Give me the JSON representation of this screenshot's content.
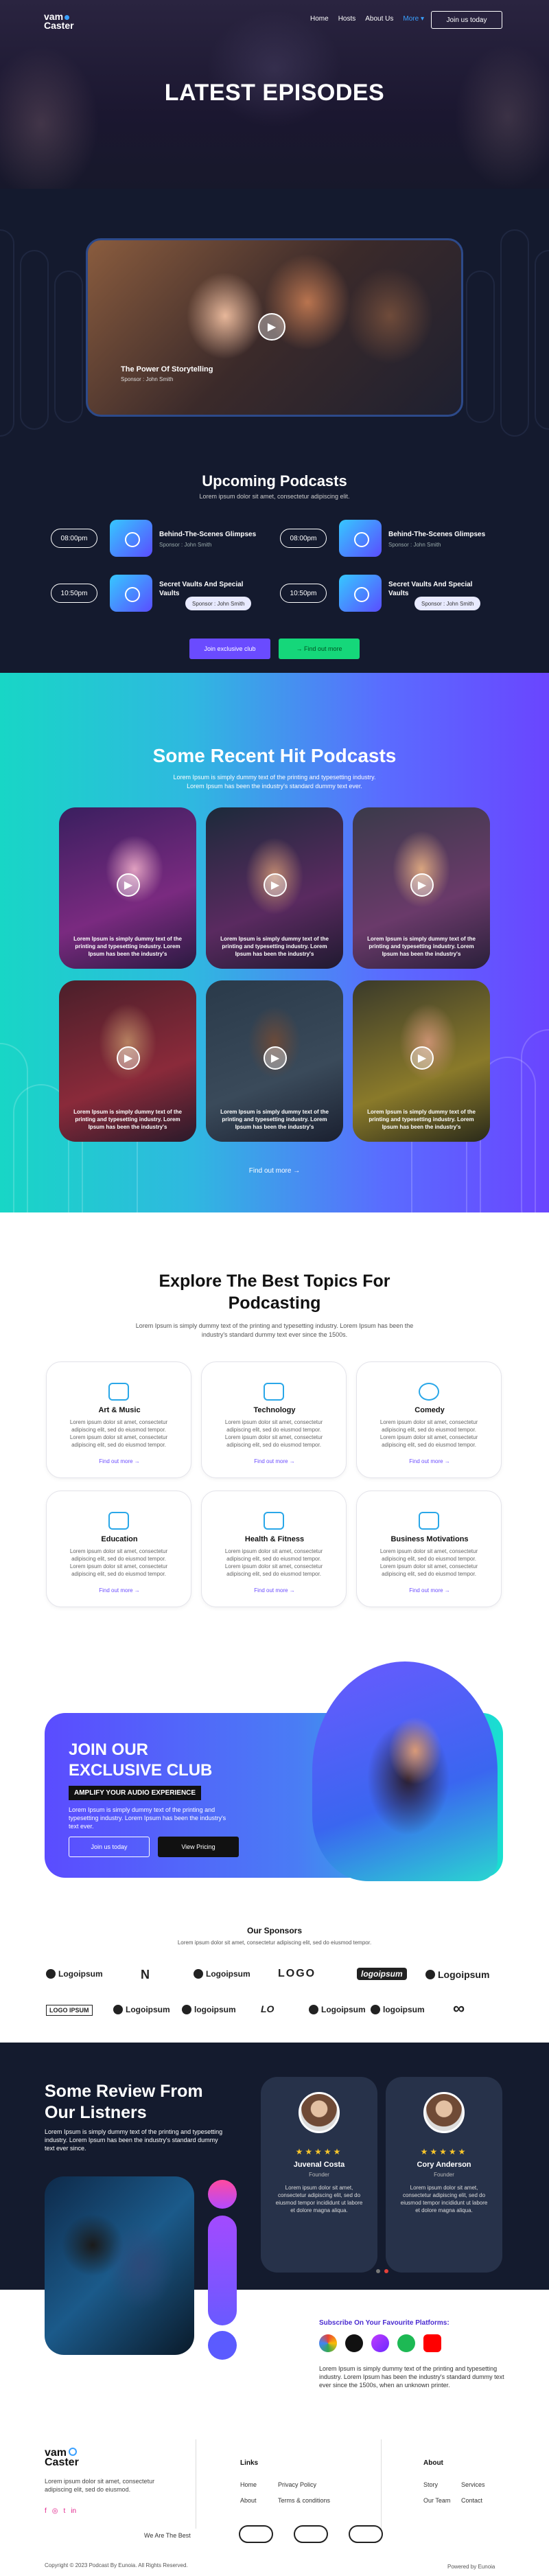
{
  "nav": {
    "logo_line1": "vam",
    "logo_line2": "Caster",
    "links": [
      "Home",
      "Hosts",
      "About Us",
      "More ▾"
    ],
    "join_label": "Join us today"
  },
  "hero": {
    "title": "LATEST EPISODES"
  },
  "featured": {
    "title": "The Power Of Storytelling",
    "sponsor": "Sponsor : John Smith"
  },
  "upcoming": {
    "title": "Upcoming Podcasts",
    "subtitle": "Lorem ipsum dolor sit amet, consectetur adipiscing elit.",
    "items": [
      {
        "time": "08:00pm",
        "title": "Behind-The-Scenes Glimpses",
        "sponsor": "Sponsor : John Smith"
      },
      {
        "time": "08:00pm",
        "title": "Behind-The-Scenes Glimpses",
        "sponsor": "Sponsor : John Smith"
      },
      {
        "time": "10:50pm",
        "title": "Secret Vaults And Special Vaults",
        "sponsor": "Sponsor : John Smith"
      },
      {
        "time": "10:50pm",
        "title": "Secret Vaults And Special Vaults",
        "sponsor": "Sponsor : John Smith"
      }
    ],
    "club_btn": "Join exclusive club",
    "find_btn": "→ Find out more"
  },
  "hits": {
    "title": "Some Recent Hit Podcasts",
    "subtitle": "Lorem Ipsum is simply dummy text of the printing and typesetting industry. Lorem Ipsum has been the industry's standard dummy text ever.",
    "card_text": "Lorem Ipsum is simply dummy text of the printing and typesetting industry. Lorem Ipsum has been the industry's",
    "find_more": "Find out more →"
  },
  "topics": {
    "title_line1": "Explore The Best Topics For",
    "title_line2": "Podcasting",
    "subtitle": "Lorem Ipsum is simply dummy text of the printing and typesetting industry. Lorem Ipsum has been the industry's standard dummy text ever since the 1500s.",
    "card_text": "Lorem ipsum dolor sit amet, consectetur adipiscing elit, sed do eiusmod tempor. Lorem ipsum dolor sit amet, consectetur adipiscing elit, sed do eiusmod tempor.",
    "find_more": "Find out more →",
    "items": [
      "Art & Music",
      "Technology",
      "Comedy",
      "Education",
      "Health & Fitness",
      "Business Motivations"
    ]
  },
  "club": {
    "line1": "JOIN OUR",
    "line2": "EXCLUSIVE CLUB",
    "tag": "AMPLIFY YOUR AUDIO EXPERIENCE",
    "text": "Lorem Ipsum is simply dummy text of the printing and typesetting industry. Lorem Ipsum has been the industry's text ever.",
    "join_btn": "Join us today",
    "pricing_btn": "View Pricing"
  },
  "sponsors": {
    "title": "Our Sponsors",
    "subtitle": "Lorem ipsum dolor sit amet, consectetur adipiscing elit, sed do eiusmod tempor.",
    "row1": [
      "Logoipsum",
      "N",
      "Logoipsum",
      "LOGO",
      "logoipsum",
      "Logoipsum"
    ],
    "row2": [
      "LOGO IPSUM",
      "Logoipsum",
      "logoipsum",
      "LO",
      "Logoipsum",
      "logoipsum",
      "∞"
    ]
  },
  "review": {
    "title_line1": "Some Review From",
    "title_line2": "Our Listners",
    "text": "Lorem Ipsum is simply dummy text of the printing and typesetting industry. Lorem Ipsum has been the industry's standard dummy text ever since.",
    "cards": [
      {
        "name": "Juvenal Costa",
        "role": "Founder",
        "stars": "★★★★★",
        "text": "Lorem ipsum dolor sit amet, consectetur adipiscing elit, sed do eiusmod tempor incididunt ut labore et dolore magna aliqua."
      },
      {
        "name": "Cory Anderson",
        "role": "Founder",
        "stars": "★★★★★",
        "text": "Lorem ipsum dolor sit amet, consectetur adipiscing elit, sed do eiusmod tempor incididunt ut labore et dolore magna aliqua."
      }
    ]
  },
  "platforms": {
    "title": "Subscribe On Your Favourite Platforms:",
    "text": "Lorem Ipsum is simply dummy text of the printing and typesetting industry. Lorem Ipsum has been the industry's standard dummy text ever since the 1500s, when an unknown printer."
  },
  "footer": {
    "about_text": "Lorem ipsum dolor sit amet, consectetur adipiscing elit, sed do eiusmod.",
    "links_head": "Links",
    "links": [
      "Home",
      "Privacy Policy",
      "About",
      "Terms & conditions"
    ],
    "about_head": "About",
    "about_links": [
      "Story",
      "Services",
      "Our Team",
      "Contact"
    ],
    "best_label": "We Are The Best",
    "copyright": "Copyright © 2023 Podcast By Eunoia. All Rights Reserved.",
    "powered": "Powered by Eunoia"
  },
  "colors": {
    "accent": "#6a4bff",
    "green": "#15d77a",
    "dark": "#141a2e",
    "blue": "#3aa0ff"
  }
}
